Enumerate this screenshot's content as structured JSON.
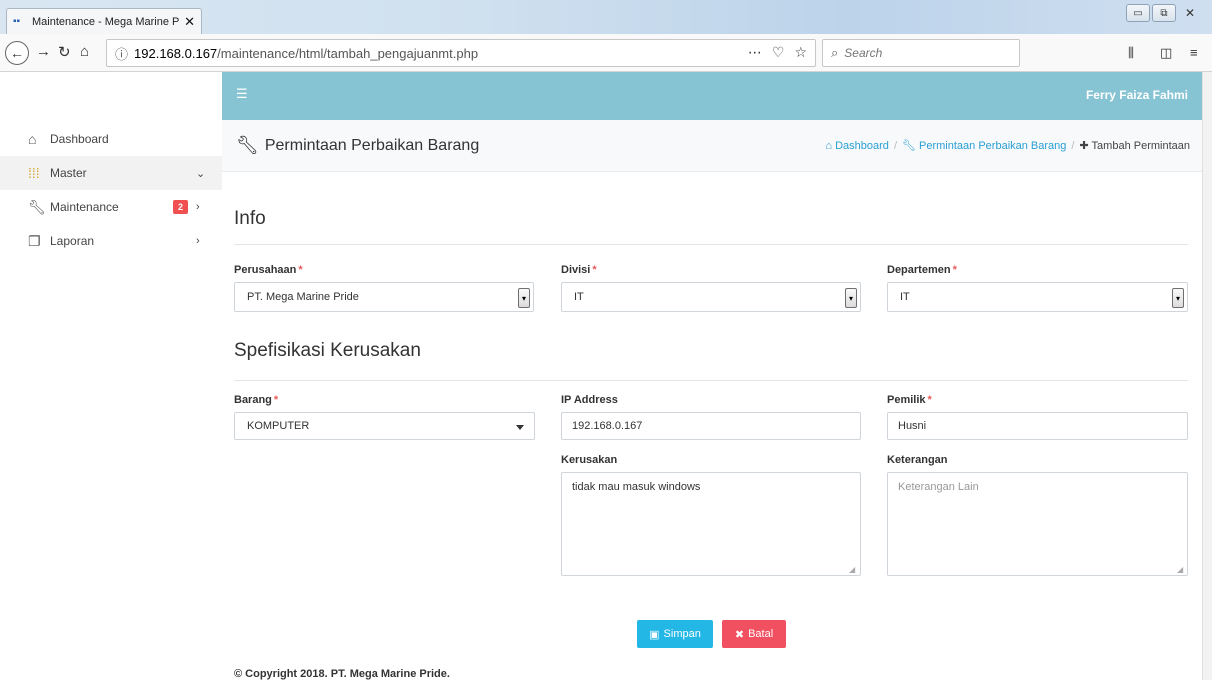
{
  "browser": {
    "tab_title": "Maintenance - Mega Marine Pr",
    "url_host": "192.168.0.167",
    "url_path": "/maintenance/html/tambah_pengajuanmt.php",
    "search_placeholder": "Search"
  },
  "app": {
    "user_name": "Ferry Faiza Fahmi"
  },
  "sidebar": {
    "items": [
      {
        "label": "Dashboard",
        "icon": "home-icon"
      },
      {
        "label": "Master",
        "icon": "grid-icon",
        "arrow": "chevron-down"
      },
      {
        "label": "Maintenance",
        "icon": "wrench-icon",
        "badge": "2",
        "arrow": "chevron-right"
      },
      {
        "label": "Laporan",
        "icon": "copy-icon",
        "arrow": "chevron-right"
      }
    ]
  },
  "header": {
    "title": "Permintaan Perbaikan Barang",
    "breadcrumb": {
      "home": "Dashboard",
      "parent": "Permintaan Perbaikan Barang",
      "current": "Tambah Permintaan"
    }
  },
  "form": {
    "info_title": "Info",
    "perusahaan_label": "Perusahaan",
    "perusahaan_value": "PT. Mega Marine Pride",
    "divisi_label": "Divisi",
    "divisi_value": "IT",
    "departemen_label": "Departemen",
    "departemen_value": "IT",
    "spec_title": "Spefisikasi Kerusakan",
    "barang_label": "Barang",
    "barang_value": "KOMPUTER",
    "ip_label": "IP Address",
    "ip_value": "192.168.0.167",
    "pemilik_label": "Pemilik",
    "pemilik_value": "Husni",
    "kerusakan_label": "Kerusakan",
    "kerusakan_value": "tidak mau masuk windows",
    "keterangan_label": "Keterangan",
    "keterangan_placeholder": "Keterangan Lain",
    "required_mark": "*"
  },
  "actions": {
    "save_label": "Simpan",
    "cancel_label": "Batal"
  },
  "footer": {
    "copyright": "© Copyright 2018. PT. Mega Marine Pride."
  },
  "colors": {
    "topbar": "#86c3d3",
    "link": "#2a9fd6",
    "save": "#23b7e5",
    "cancel": "#f05060",
    "badge": "#f05050",
    "required": "#e85a5a"
  }
}
